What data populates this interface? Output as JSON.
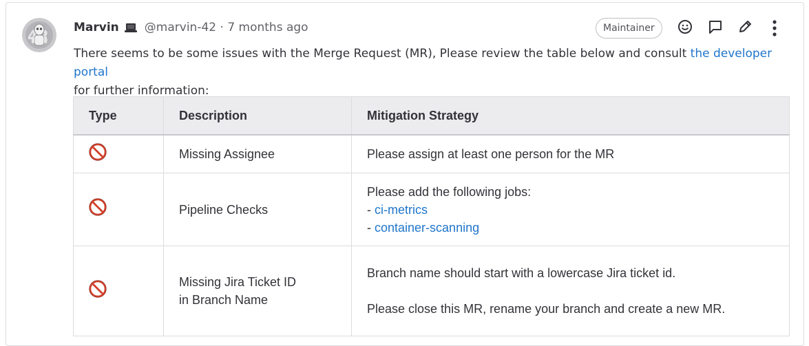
{
  "comment": {
    "author": "Marvin",
    "handle": "@marvin-42",
    "separator": "·",
    "time_ago": "7 months ago",
    "role_badge": "Maintainer",
    "intro_before_link": "There seems to be some issues with the Merge Request (MR), Please review the table below and consult ",
    "intro_link": "the developer portal",
    "intro_after_link": "for further information:"
  },
  "actions": [
    "smiley-icon",
    "comment-icon",
    "pencil-icon",
    "kebab-menu-icon"
  ],
  "table": {
    "headers": [
      "Type",
      "Description",
      "Mitigation Strategy"
    ],
    "rows": [
      {
        "type_icon": "prohibited-icon",
        "description": "Missing Assignee",
        "mitigation": "Please assign at least one person for the MR"
      },
      {
        "type_icon": "prohibited-icon",
        "description": "Pipeline Checks",
        "mitigation_intro": "Please add the following jobs:",
        "jobs": [
          "ci-metrics",
          "container-scanning"
        ],
        "bullet": "- "
      },
      {
        "type_icon": "prohibited-icon",
        "description_line1": "Missing Jira Ticket ID",
        "description_line2": "in Branch Name",
        "mitigation_line1": "Branch name should start with a lowercase Jira ticket id.",
        "mitigation_line2": "Please close this MR, rename your branch and create a new MR."
      }
    ]
  },
  "colors": {
    "link": "#1f75cb",
    "prohibited": "#d3402b",
    "header_bg": "#ececef",
    "border": "#dcdcde"
  }
}
